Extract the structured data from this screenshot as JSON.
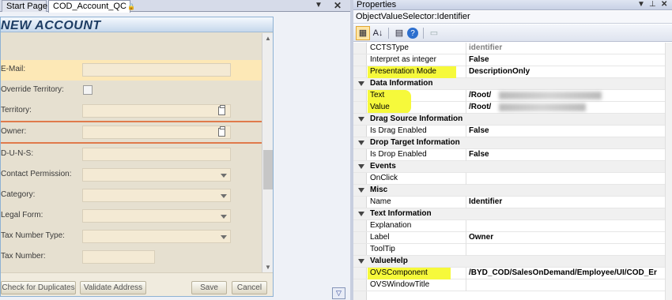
{
  "tabs": {
    "start_page": "Start Page",
    "active": "COD_Account_QC",
    "active_lock": "🔒",
    "dropdown_glyph": "▼",
    "close_glyph": "✕"
  },
  "form": {
    "title": "NEW ACCOUNT",
    "fields": {
      "email": "E-Mail:",
      "override_territory": "Override Territory:",
      "territory": "Territory:",
      "owner": "Owner:",
      "duns": "D-U-N-S:",
      "contact_permission": "Contact Permission:",
      "category": "Category:",
      "legal_form": "Legal Form:",
      "tax_number_type": "Tax Number Type:",
      "tax_number": "Tax Number:"
    },
    "buttons": {
      "check_duplicates": "Check for Duplicates",
      "validate_address": "Validate Address",
      "save": "Save",
      "cancel": "Cancel"
    },
    "canvas_dropdown": "▽"
  },
  "properties": {
    "title": "Properties",
    "ctrl_dropdown": "▼",
    "ctrl_pin": "⊥",
    "ctrl_close": "✕",
    "object": "ObjectValueSelector:Identifier",
    "toolbar": {
      "categorized": "▦",
      "alphabetical": "A↓",
      "properties_page": "▤",
      "events": "?",
      "property_pages": "▭"
    },
    "rows": {
      "ccts": {
        "name": "CCTSType",
        "value": "identifier"
      },
      "interpret": {
        "name": "Interpret as integer",
        "value": "False"
      },
      "presentation": {
        "name": "Presentation Mode",
        "value": "DescriptionOnly"
      },
      "cat_data": "Data Information",
      "text": {
        "name": "Text",
        "value": "/Root/"
      },
      "value": {
        "name": "Value",
        "value": "/Root/"
      },
      "cat_drag": "Drag Source Information",
      "drag_enabled": {
        "name": "Is Drag Enabled",
        "value": "False"
      },
      "cat_drop": "Drop Target Information",
      "drop_enabled": {
        "name": "Is Drop Enabled",
        "value": "False"
      },
      "cat_events": "Events",
      "onclick": {
        "name": "OnClick",
        "value": ""
      },
      "cat_misc": "Misc",
      "name": {
        "name": "Name",
        "value": "Identifier"
      },
      "cat_text": "Text Information",
      "explanation": {
        "name": "Explanation",
        "value": ""
      },
      "label": {
        "name": "Label",
        "value": "Owner"
      },
      "tooltip": {
        "name": "ToolTip",
        "value": ""
      },
      "cat_valuehelp": "ValueHelp",
      "ovscomponent": {
        "name": "OVSComponent",
        "value": "/BYD_COD/SalesOnDemand/Employee/UI/COD_Er"
      },
      "ovswindowtitle": {
        "name": "OVSWindowTitle",
        "value": ""
      }
    }
  },
  "colors": {
    "highlight": "#f6f93b",
    "form_highlight_row": "#fde8b6",
    "required_line": "#e07a4b",
    "form_title": "#1d3c63"
  }
}
